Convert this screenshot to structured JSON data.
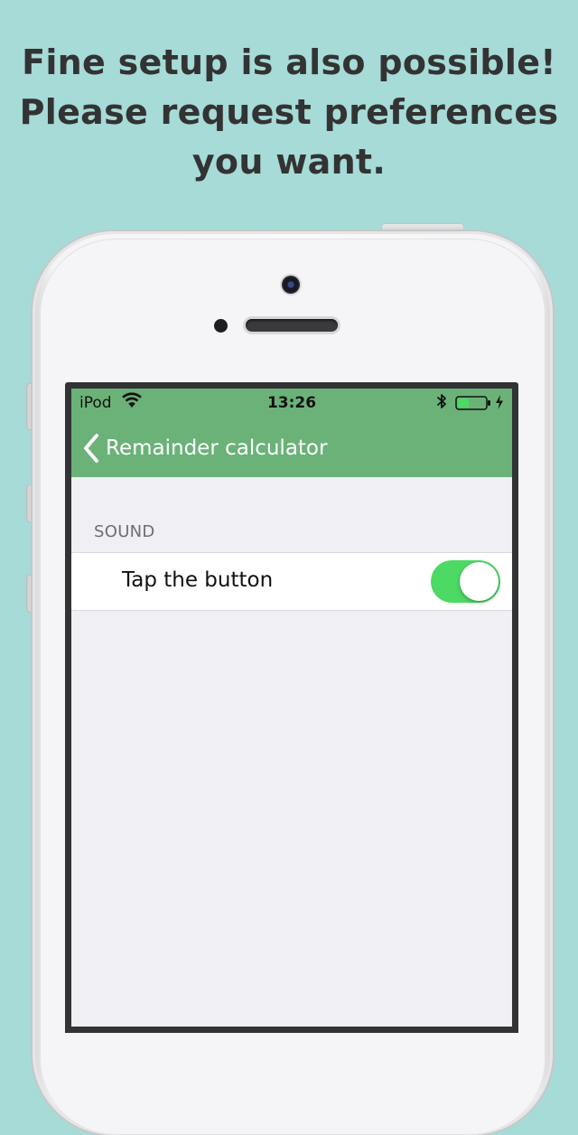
{
  "promo": {
    "line1": "Fine setup is also possible!",
    "line2": "Please request preferences",
    "line3": "you want."
  },
  "status_bar": {
    "carrier": "iPod",
    "time": "13:26",
    "battery_level": 0.4,
    "icons": [
      "wifi-icon",
      "bluetooth-icon",
      "battery-icon",
      "charging-icon"
    ]
  },
  "nav": {
    "back_label": "Remainder calculator",
    "back_icon": "chevron-left-icon"
  },
  "settings": {
    "section_header": "SOUND",
    "row_label": "Tap the button",
    "toggle_on": true
  },
  "colors": {
    "background": "#a6dbd7",
    "nav_bar": "#6bb278",
    "toggle_on": "#4cd964",
    "promo_text": "#333333"
  }
}
